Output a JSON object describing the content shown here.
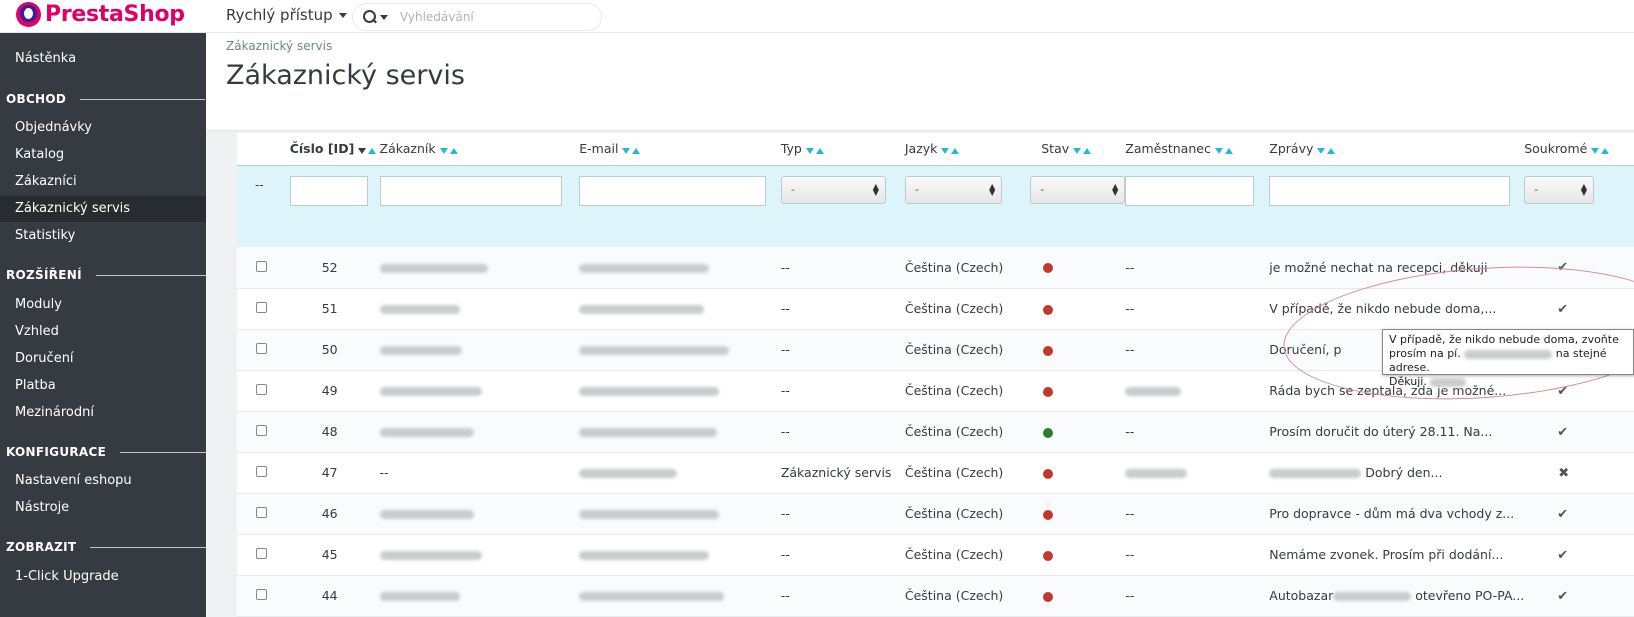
{
  "app": {
    "logo_text": "PrestaShop"
  },
  "header": {
    "quick_access": "Rychlý přístup",
    "search_placeholder": "Vyhledávání"
  },
  "sidebar": {
    "dashboard": "Nástěnka",
    "sections": [
      {
        "title": "OBCHOD",
        "items": [
          "Objednávky",
          "Katalog",
          "Zákazníci",
          "Zákaznický servis",
          "Statistiky"
        ]
      },
      {
        "title": "ROZŠÍŘENÍ",
        "items": [
          "Moduly",
          "Vzhled",
          "Doručení",
          "Platba",
          "Mezinárodní"
        ]
      },
      {
        "title": "KONFIGURACE",
        "items": [
          "Nastavení eshopu",
          "Nástroje"
        ]
      },
      {
        "title": "ZOBRAZIT",
        "items": [
          "1-Click Upgrade"
        ]
      }
    ],
    "active": "Zákaznický servis"
  },
  "breadcrumb": "Zákaznický servis",
  "page_title": "Zákaznický servis",
  "table": {
    "columns": [
      "Číslo [ID]",
      "Zákazník",
      "E-mail",
      "Typ",
      "Jazyk",
      "Stav",
      "Zaměstnanec",
      "Zprávy",
      "Soukromé"
    ],
    "filter_bulk": "--",
    "filter_select": "-",
    "rows": [
      {
        "id": "52",
        "customer": "",
        "type": "--",
        "lang": "Čeština (Czech)",
        "status": "#c0392b",
        "employee": "--",
        "message": "je možné nechat na recepci, děkuji",
        "private": "check"
      },
      {
        "id": "51",
        "customer": "",
        "type": "--",
        "lang": "Čeština (Czech)",
        "status": "#c0392b",
        "employee": "--",
        "message": "V případě, že nikdo nebude doma,...",
        "private": "check"
      },
      {
        "id": "50",
        "customer": "",
        "type": "--",
        "lang": "Čeština (Czech)",
        "status": "#c0392b",
        "employee": "--",
        "message": "Doručení, p",
        "private": ""
      },
      {
        "id": "49",
        "customer": "",
        "type": "--",
        "lang": "Čeština (Czech)",
        "status": "#c0392b",
        "employee": "",
        "message": "Ráda bych se zeptala, zda je možné...",
        "private": "check"
      },
      {
        "id": "48",
        "customer": "",
        "type": "--",
        "lang": "Čeština (Czech)",
        "status": "#2e7d32",
        "employee": "--",
        "message": "Prosím doručit do úterý 28.11. Na...",
        "private": "check"
      },
      {
        "id": "47",
        "customer": "--",
        "type": "Zákaznický servis",
        "lang": "Čeština (Czech)",
        "status": "#c0392b",
        "employee": "",
        "message": "Dobrý den...",
        "private": "x"
      },
      {
        "id": "46",
        "customer": "",
        "type": "--",
        "lang": "Čeština (Czech)",
        "status": "#c0392b",
        "employee": "--",
        "message": "Pro dopravce - dům má dva vchody z...",
        "private": "check"
      },
      {
        "id": "45",
        "customer": "",
        "type": "--",
        "lang": "Čeština (Czech)",
        "status": "#c0392b",
        "employee": "--",
        "message": "Nemáme zvonek. Prosím při dodání...",
        "private": "check"
      },
      {
        "id": "44",
        "customer": "",
        "type": "--",
        "lang": "Čeština (Czech)",
        "status": "#c0392b",
        "employee": "--",
        "message": "Autobazar",
        "message_tail": "otevřeno PO-PA...",
        "private": "check"
      }
    ]
  },
  "tooltip": {
    "line1": "V případě, že nikdo nebude doma, zvoňte",
    "line2a": "prosím na pí.",
    "line2b": "na stejné adrese.",
    "line3": "Děkuji."
  },
  "colors": {
    "sidebar": "#363a41",
    "accent": "#25b9d7",
    "brand": "#df0067"
  }
}
